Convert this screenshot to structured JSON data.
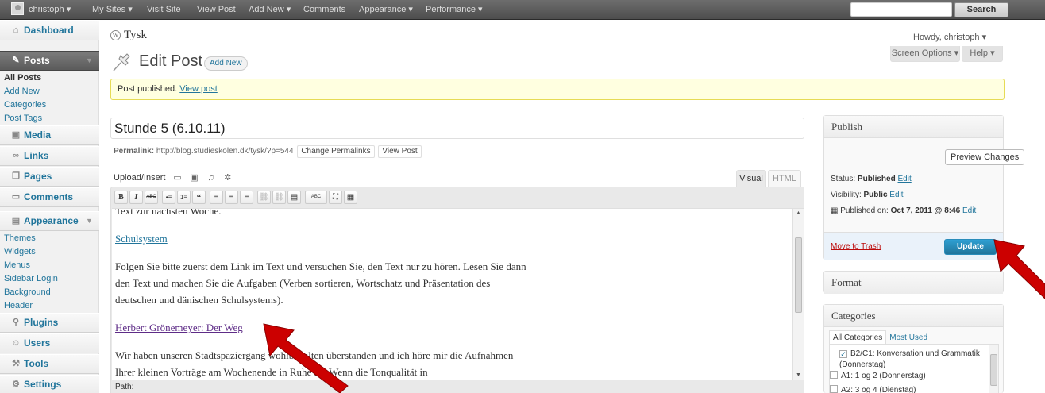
{
  "admin_bar": {
    "items": [
      "christoph ▾",
      "My Sites ▾",
      "Visit Site",
      "View Post",
      "Add New ▾",
      "Comments",
      "Appearance ▾",
      "Performance ▾"
    ],
    "search_button": "Search",
    "search_value": ""
  },
  "sidebar": {
    "dashboard": "Dashboard",
    "posts": "Posts",
    "posts_sub": [
      "All Posts",
      "Add New",
      "Categories",
      "Post Tags"
    ],
    "media": "Media",
    "links": "Links",
    "pages": "Pages",
    "comments": "Comments",
    "appearance": "Appearance",
    "appearance_sub": [
      "Themes",
      "Widgets",
      "Menus",
      "Sidebar Login",
      "Background",
      "Header"
    ],
    "plugins": "Plugins",
    "users": "Users",
    "tools": "Tools",
    "settings": "Settings"
  },
  "header": {
    "site_title": "Tysk",
    "howdy": "Howdy, christoph ▾",
    "screen_options": "Screen Options ▾",
    "help": "Help ▾"
  },
  "page": {
    "title": "Edit Post",
    "add_new": "Add New",
    "notice_text": "Post published.",
    "notice_link": "View post"
  },
  "post": {
    "title": "Stunde 5 (6.10.11)",
    "permalink_label": "Permalink:",
    "permalink_url": "http://blog.studieskolen.dk/tysk/?p=544",
    "change_permalinks": "Change Permalinks",
    "view_post": "View Post"
  },
  "editor": {
    "upload_insert": "Upload/Insert",
    "tab_visual": "Visual",
    "tab_html": "HTML",
    "path_label": "Path:",
    "toolbar_buttons": [
      "B",
      "I",
      "ABC",
      "•≡",
      "1≡",
      "“",
      "≡",
      "≡",
      "≡",
      "⛓",
      "⛓",
      "▤",
      "ABC",
      "⛶",
      "▦"
    ],
    "content": {
      "p0": "Text zur nächsten Woche.",
      "link1": "Schulsystem",
      "p2": "Folgen Sie bitte zuerst dem Link im Text und versuchen Sie, den Text nur zu hören. Lesen Sie dann den Text und machen Sie die Aufgaben (Verben sortieren, Wortschatz und Präsentation des deutschen und dänischen Schulsystems).",
      "link3": "Herbert Grönemeyer: Der Weg",
      "p4": "Wir haben unseren Stadtspaziergang wohlbehalten überstanden und ich höre mir die Aufnahmen Ihrer kleinen Vorträge am Wochenende in Ruhe an. Wenn die Tonqualität in"
    }
  },
  "publish": {
    "heading": "Publish",
    "preview": "Preview Changes",
    "status_label": "Status:",
    "status_value": "Published",
    "visibility_label": "Visibility:",
    "visibility_value": "Public",
    "published_label": "Published on:",
    "published_value": "Oct 7, 2011 @ 8:46",
    "edit": "Edit",
    "trash": "Move to Trash",
    "update": "Update"
  },
  "format": {
    "heading": "Format"
  },
  "categories": {
    "heading": "Categories",
    "tab_all": "All Categories",
    "tab_used": "Most Used",
    "items": [
      {
        "label": "B2/C1: Konversation und Grammatik (Donnerstag)",
        "checked": true
      },
      {
        "label": "A1: 1 og 2 (Donnerstag)",
        "checked": false
      },
      {
        "label": "A2: 3 og 4 (Dienstag)",
        "checked": false
      }
    ]
  },
  "colors": {
    "accent": "#21759b",
    "annotation_arrow": "#cc0000",
    "notice_bg": "#ffffe0"
  }
}
